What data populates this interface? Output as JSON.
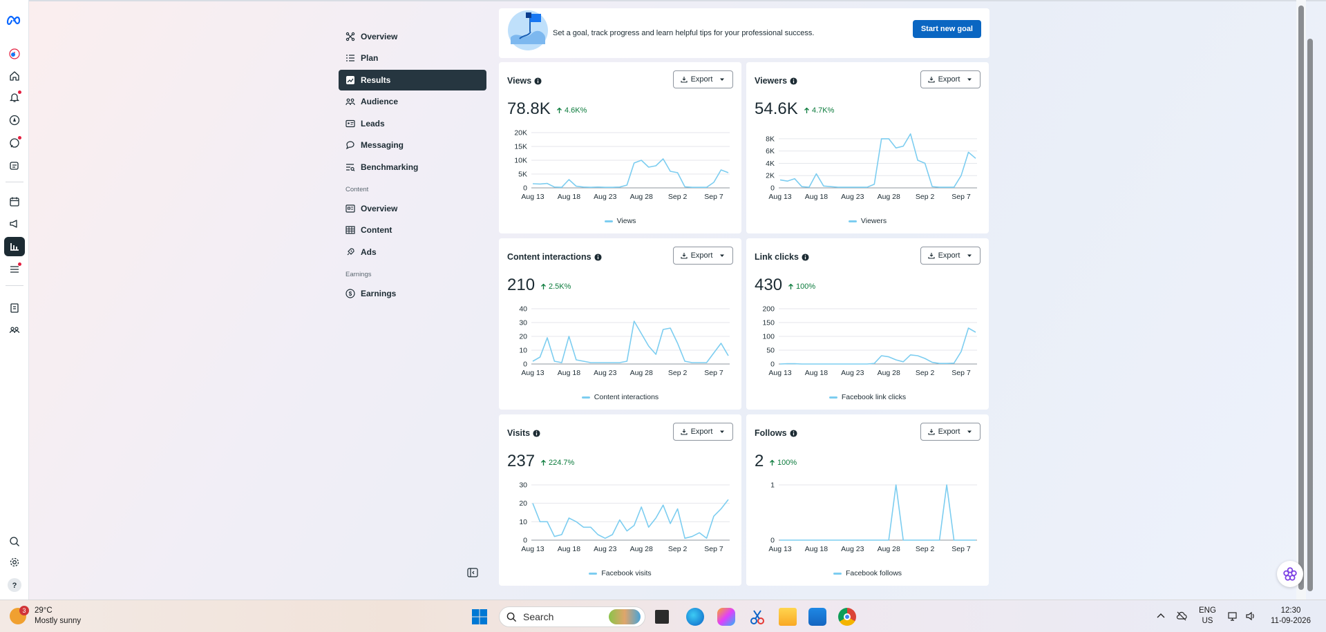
{
  "nav": {
    "items": [
      {
        "label": "Overview",
        "icon": "overview-icon",
        "active": false
      },
      {
        "label": "Plan",
        "icon": "list-icon",
        "active": false
      },
      {
        "label": "Results",
        "icon": "chart-trend-icon",
        "active": true
      },
      {
        "label": "Audience",
        "icon": "people-icon",
        "active": false
      },
      {
        "label": "Leads",
        "icon": "id-card-icon",
        "active": false
      },
      {
        "label": "Messaging",
        "icon": "chat-icon",
        "active": false
      },
      {
        "label": "Benchmarking",
        "icon": "benchmark-icon",
        "active": false
      }
    ],
    "content_section": "Content",
    "content_items": [
      {
        "label": "Overview",
        "icon": "content-overview-icon"
      },
      {
        "label": "Content",
        "icon": "table-icon"
      },
      {
        "label": "Ads",
        "icon": "rocket-icon"
      }
    ],
    "earnings_section": "Earnings",
    "earnings_items": [
      {
        "label": "Earnings",
        "icon": "dollar-icon"
      }
    ]
  },
  "goal": {
    "text": "Set a goal, track progress and learn helpful tips for your professional success.",
    "button": "Start new goal"
  },
  "export_label": "Export",
  "colors": {
    "line": "#7ccdf0",
    "accent": "#0a66c2",
    "positive": "#0a7a3b",
    "dark": "#263640"
  },
  "cards": [
    {
      "title": "Views",
      "value": "78.8K",
      "change": "4.6K%",
      "legend": "Views"
    },
    {
      "title": "Viewers",
      "value": "54.6K",
      "change": "4.7K%",
      "legend": "Viewers"
    },
    {
      "title": "Content interactions",
      "value": "210",
      "change": "2.5K%",
      "legend": "Content interactions"
    },
    {
      "title": "Link clicks",
      "value": "430",
      "change": "100%",
      "legend": "Facebook link clicks"
    },
    {
      "title": "Visits",
      "value": "237",
      "change": "224.7%",
      "legend": "Facebook visits"
    },
    {
      "title": "Follows",
      "value": "2",
      "change": "100%",
      "legend": "Facebook follows"
    }
  ],
  "chart_data": [
    {
      "type": "line",
      "x_ticks": [
        "Aug 13",
        "Aug 18",
        "Aug 23",
        "Aug 28",
        "Sep 2",
        "Sep 7"
      ],
      "ylim": [
        0,
        20000
      ],
      "y_ticks": [
        "0",
        "5K",
        "10K",
        "15K",
        "20K"
      ],
      "y_tick_values": [
        0,
        5000,
        10000,
        15000,
        20000
      ],
      "series": [
        {
          "name": "Views",
          "values": [
            1500,
            1400,
            1600,
            300,
            200,
            3000,
            600,
            300,
            200,
            300,
            200,
            200,
            300,
            1000,
            9000,
            10000,
            7500,
            8000,
            10500,
            6000,
            5500,
            400,
            200,
            200,
            200,
            2000,
            6500,
            5500
          ]
        }
      ]
    },
    {
      "type": "line",
      "x_ticks": [
        "Aug 13",
        "Aug 18",
        "Aug 23",
        "Aug 28",
        "Sep 2",
        "Sep 7"
      ],
      "ylim": [
        0,
        9000
      ],
      "y_ticks": [
        "0",
        "2K",
        "4K",
        "6K",
        "8K"
      ],
      "y_tick_values": [
        0,
        2000,
        4000,
        6000,
        8000
      ],
      "series": [
        {
          "name": "Viewers",
          "values": [
            1300,
            1100,
            1500,
            200,
            100,
            2300,
            300,
            200,
            100,
            100,
            100,
            100,
            100,
            600,
            8000,
            8000,
            6500,
            6800,
            8800,
            4500,
            4000,
            200,
            100,
            100,
            100,
            2000,
            5800,
            4800
          ]
        }
      ]
    },
    {
      "type": "line",
      "x_ticks": [
        "Aug 13",
        "Aug 18",
        "Aug 23",
        "Aug 28",
        "Sep 2",
        "Sep 7"
      ],
      "ylim": [
        0,
        40
      ],
      "y_ticks": [
        "0",
        "10",
        "20",
        "30",
        "40"
      ],
      "y_tick_values": [
        0,
        10,
        20,
        30,
        40
      ],
      "series": [
        {
          "name": "Content interactions",
          "values": [
            2,
            5,
            19,
            2,
            1,
            20,
            3,
            2,
            1,
            1,
            1,
            1,
            1,
            2,
            31,
            22,
            13,
            7,
            25,
            26,
            15,
            2,
            1,
            1,
            1,
            8,
            15,
            6
          ]
        }
      ]
    },
    {
      "type": "line",
      "x_ticks": [
        "Aug 13",
        "Aug 18",
        "Aug 23",
        "Aug 28",
        "Sep 2",
        "Sep 7"
      ],
      "ylim": [
        0,
        200
      ],
      "y_ticks": [
        "0",
        "50",
        "100",
        "150",
        "200"
      ],
      "y_tick_values": [
        0,
        50,
        100,
        150,
        200
      ],
      "series": [
        {
          "name": "Facebook link clicks",
          "values": [
            0,
            1,
            1,
            0,
            0,
            0,
            0,
            0,
            0,
            0,
            0,
            0,
            0,
            2,
            30,
            26,
            15,
            8,
            33,
            30,
            20,
            6,
            2,
            2,
            3,
            45,
            130,
            115
          ]
        }
      ]
    },
    {
      "type": "line",
      "x_ticks": [
        "Aug 13",
        "Aug 18",
        "Aug 23",
        "Aug 28",
        "Sep 2",
        "Sep 7"
      ],
      "ylim": [
        0,
        30
      ],
      "y_ticks": [
        "0",
        "10",
        "20",
        "30"
      ],
      "y_tick_values": [
        0,
        10,
        20,
        30
      ],
      "series": [
        {
          "name": "Facebook visits",
          "values": [
            20,
            10,
            10,
            2,
            3,
            12,
            10,
            7,
            7,
            3,
            1,
            3,
            11,
            5,
            8,
            18,
            7,
            12,
            19,
            9,
            17,
            1,
            2,
            4,
            1,
            13,
            17,
            22
          ]
        }
      ]
    },
    {
      "type": "line",
      "x_ticks": [
        "Aug 13",
        "Aug 18",
        "Aug 23",
        "Aug 28",
        "Sep 2",
        "Sep 7"
      ],
      "ylim": [
        0,
        1
      ],
      "y_ticks": [
        "0",
        "1"
      ],
      "y_tick_values": [
        0,
        1
      ],
      "series": [
        {
          "name": "Facebook follows",
          "values": [
            0,
            0,
            0,
            0,
            0,
            0,
            0,
            0,
            0,
            0,
            0,
            0,
            0,
            0,
            0,
            0,
            1,
            0,
            0,
            0,
            0,
            0,
            0,
            1,
            0,
            0,
            0,
            0
          ]
        }
      ]
    }
  ],
  "taskbar": {
    "weather_temp": "29°C",
    "weather_desc": "Mostly sunny",
    "weather_badge": "3",
    "search_placeholder": "Search",
    "lang": "ENG",
    "region": "US",
    "time": "12:30",
    "date": "11-09-2026"
  }
}
